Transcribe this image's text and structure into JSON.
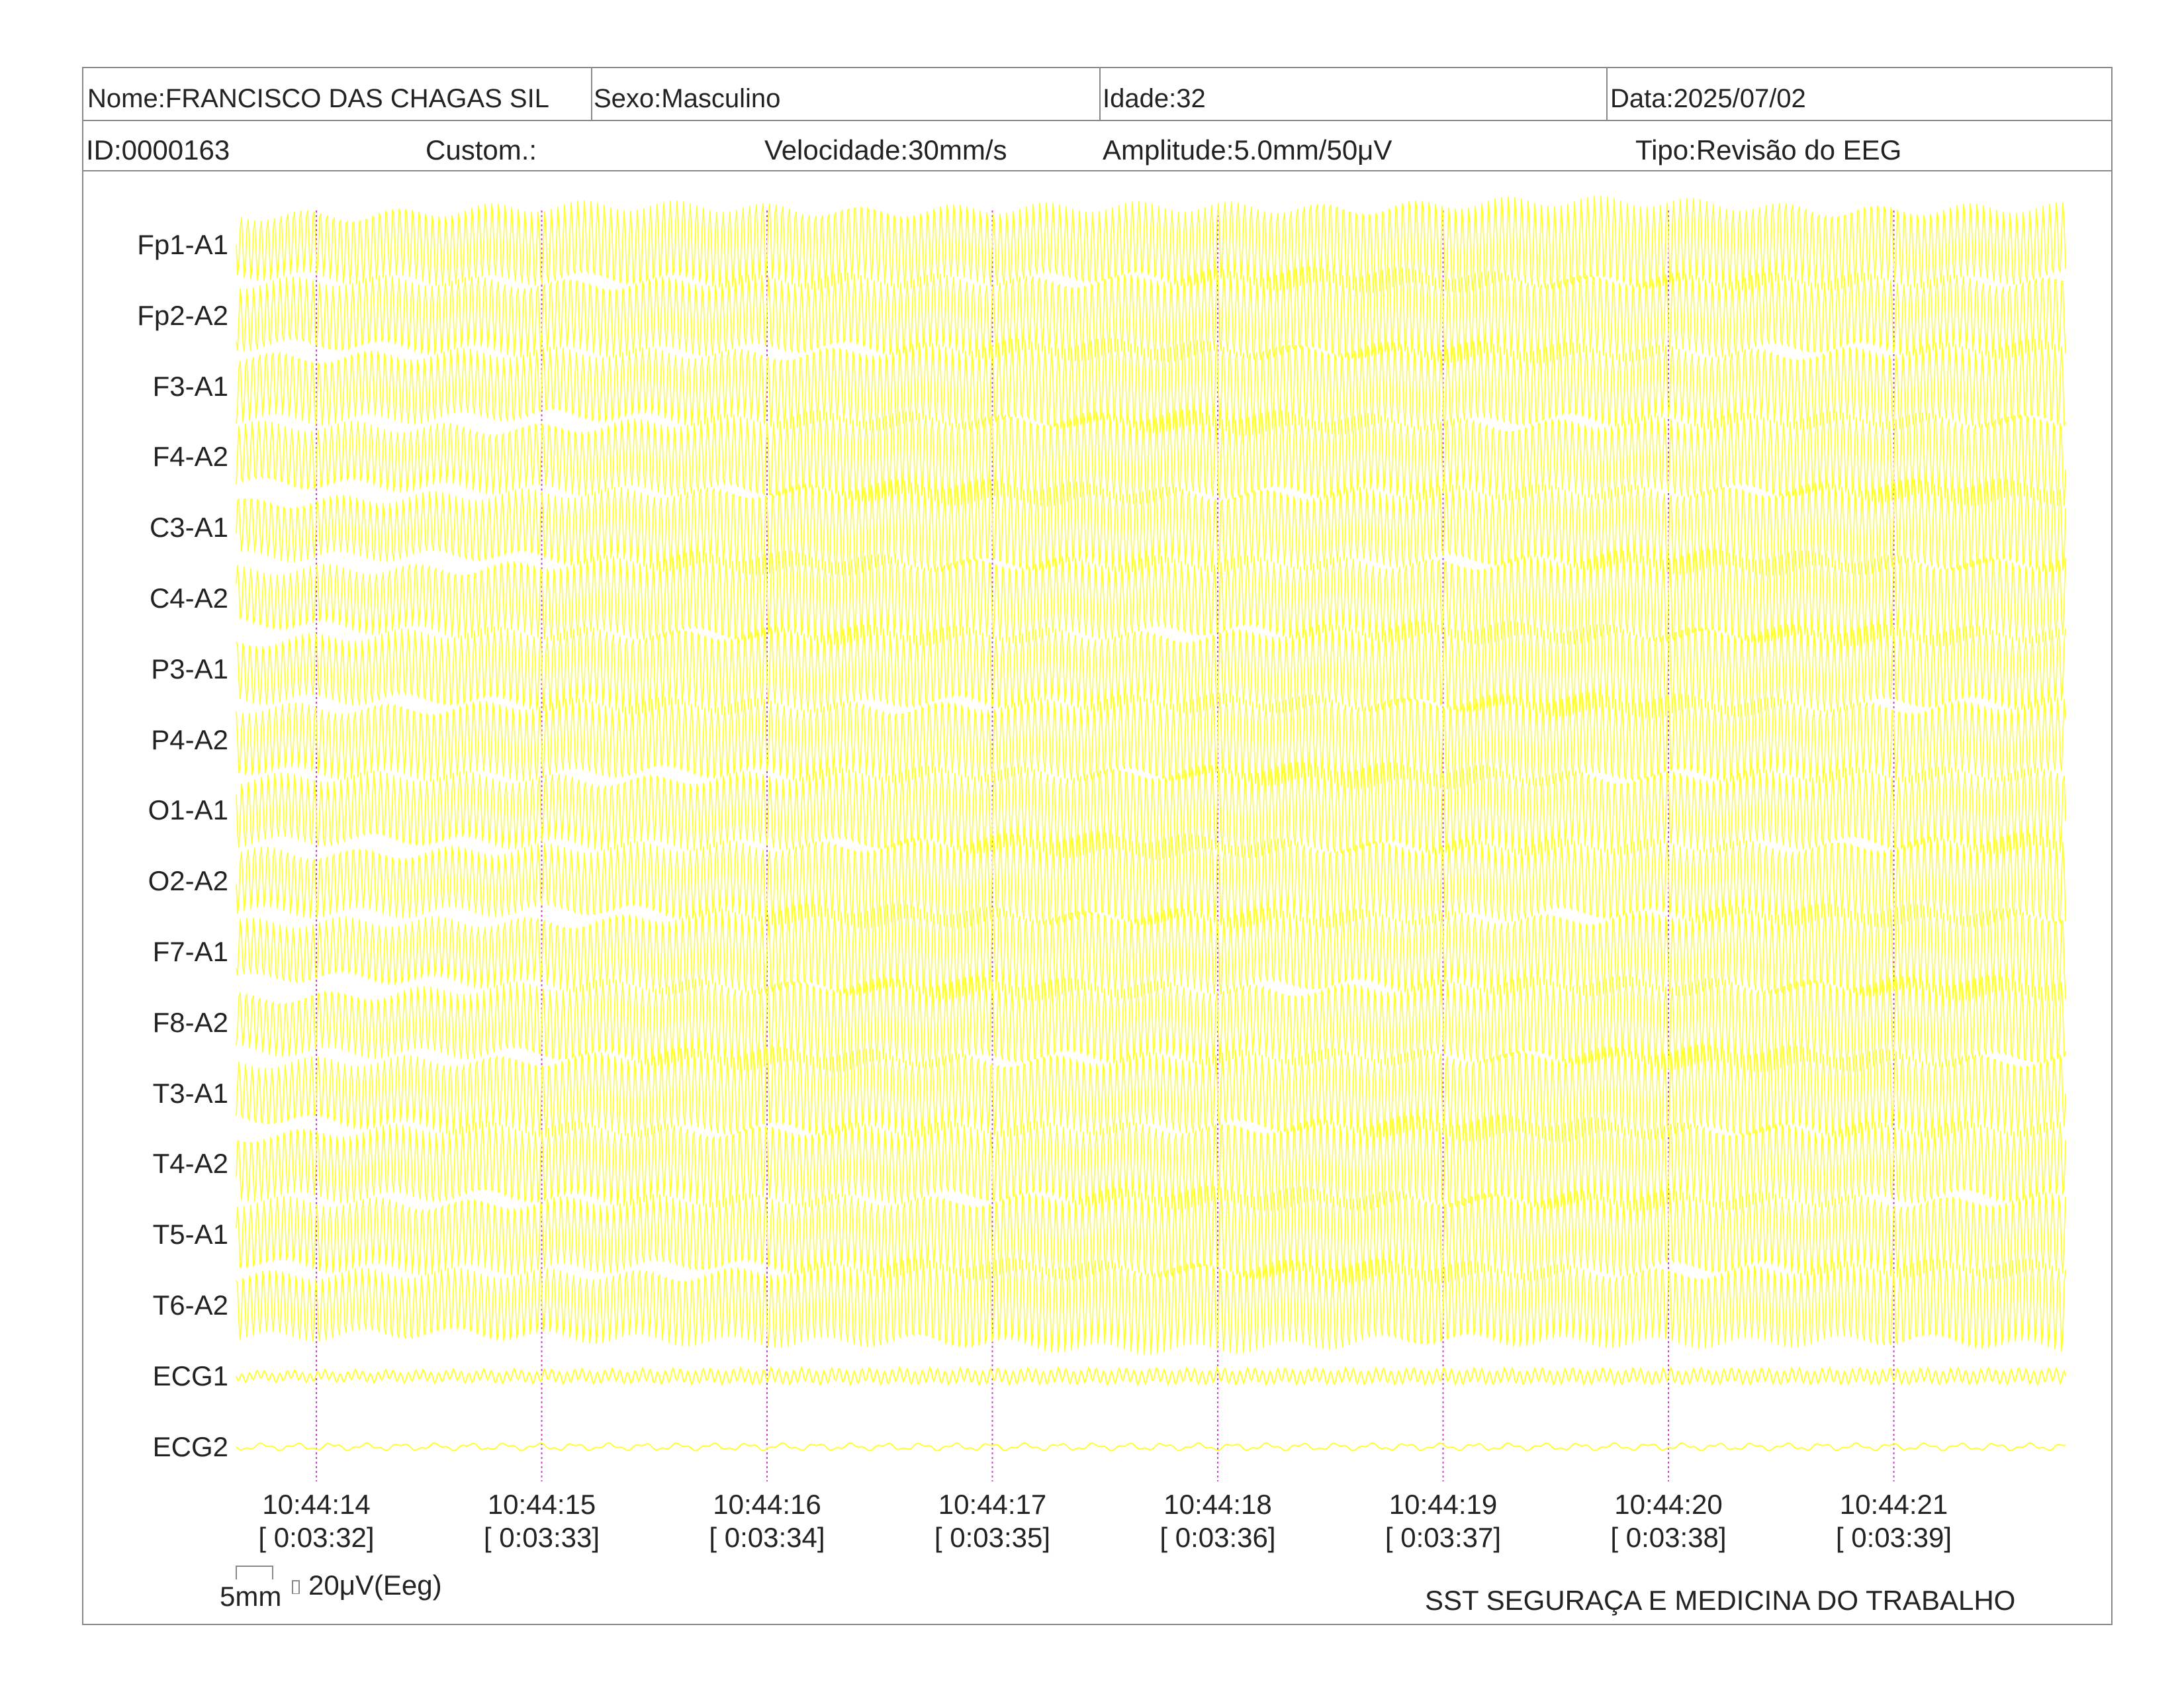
{
  "header": {
    "nome": "Nome:FRANCISCO DAS CHAGAS SIL",
    "sexo": "Sexo:Masculino",
    "idade": "Idade:32",
    "data": "Data:2025/07/02",
    "id": "ID:0000163",
    "custom": "Custom.:",
    "velocidade": "Velocidade:30mm/s",
    "amplitude": "Amplitude:5.0mm/50μV",
    "tipo": "Tipo:Revisão do EEG"
  },
  "colors": {
    "trace": "#ffff33",
    "time_marker": "#cc44cc",
    "border": "#888888"
  },
  "chart_data": {
    "type": "line",
    "channels": [
      "Fp1-A1",
      "Fp2-A2",
      "F3-A1",
      "F4-A2",
      "C3-A1",
      "C4-A2",
      "P3-A1",
      "P4-A2",
      "O1-A1",
      "O2-A2",
      "F7-A1",
      "F8-A2",
      "T3-A1",
      "T4-A2",
      "T5-A1",
      "T6-A2",
      "ECG1",
      "ECG2"
    ],
    "time_labels": [
      "10:44:14",
      "10:44:15",
      "10:44:16",
      "10:44:17",
      "10:44:18",
      "10:44:19",
      "10:44:20",
      "10:44:21"
    ],
    "elapsed_labels": [
      "[ 0:03:32]",
      "[ 0:03:33]",
      "[ 0:03:34]",
      "[ 0:03:35]",
      "[ 0:03:36]",
      "[ 0:03:37]",
      "[ 0:03:38]",
      "[ 0:03:39]"
    ],
    "scale_time": "5mm",
    "scale_amplitude": "20μV(Eeg)"
  },
  "footer": {
    "company": "SST SEGURAÇA E MEDICINA DO TRABALHO"
  }
}
